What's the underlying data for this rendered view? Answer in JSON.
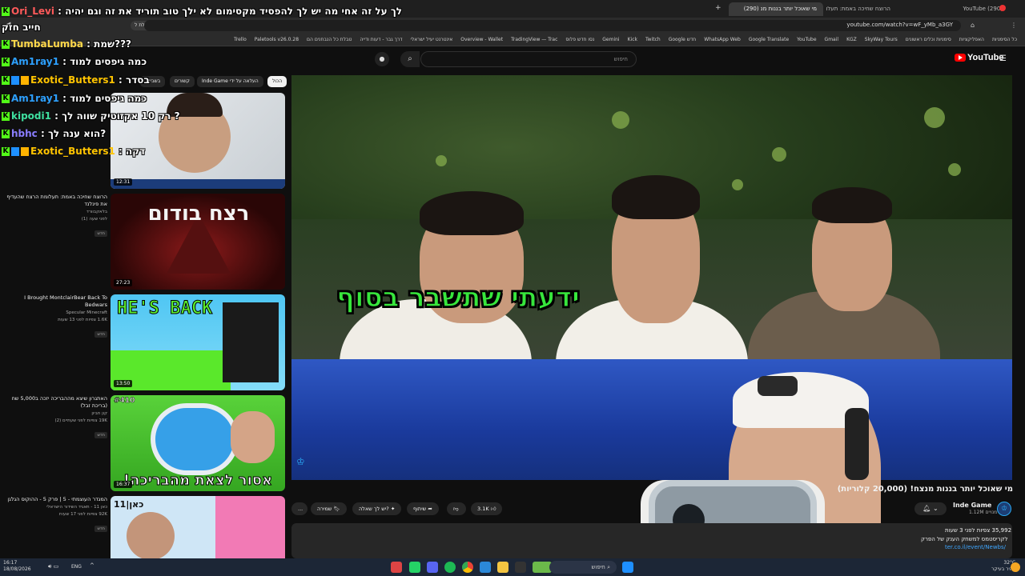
{
  "browser": {
    "tabs": [
      {
        "label": "YouTube (290)",
        "active": false
      },
      {
        "label": "הרוצח שחיכה באמת: תעלו (290)",
        "active": false
      },
      {
        "label": "מי שאוכל יותר בננות מנ (290)",
        "active": true
      }
    ],
    "new_tab": "+",
    "url": "youtube.com/watch?v=wF_yMb_a3GY",
    "profile_label": "שאכלת ל- Google",
    "bookmarks": [
      "Trello",
      "Paletools v26.0.28",
      "טבלת כל הנבחנים הם",
      "דרך גבר - דעות ודייה",
      "אינטרנט יעיל ישראלי",
      "Overview - Wallet",
      "TradingView — Trac",
      "נסו חדש פלוס",
      "Gemini",
      "Kick",
      "Twitch",
      "Google חדש",
      "WhatsApp Web",
      "Google Translate",
      "YouTube",
      "Gmail",
      "KGZ",
      "SkyWay Tours",
      "סימניות וכלים ראשונים",
      "האפליקציות",
      "כל הסימניות"
    ]
  },
  "youtube": {
    "logo": "YouTube",
    "search_placeholder": "חיפוש",
    "chips": [
      "הכול",
      "Inde Game העלאה על ידי",
      "קשורים",
      "בשבילך",
      "בסדר"
    ],
    "video": {
      "overlay_text": "ידעתי שתשבר בסוף",
      "title": "מי שאוכל יותר בננות מנצח! (20,000 קלוריות)",
      "channel": "Inde Game",
      "subscribers": "1.12M מנויים",
      "likes": "3.1K",
      "share_label": "שיתוף",
      "ask_label": "יש לך שאלה?",
      "save_label": "שמירה",
      "more_label": "...",
      "stats": "35,992 צפיות  לפני 3 שעות",
      "desc_line1": "לקריסטמס למשחק הענק של הפרק",
      "desc_line2": "ter.co.il/event/Newbs/"
    },
    "recommended": [
      {
        "title": "הרוצח שחיכה באמת: תעלומת הרצח שהעדיף את פינלנד",
        "channel": "בלאקבוורד",
        "meta": "לפני שעה (1)",
        "badge": "חדש",
        "duration": "12:31"
      },
      {
        "title": "רצח בודום",
        "channel": "",
        "meta": "",
        "badge": "",
        "duration": "27:23"
      },
      {
        "title": "I Brought MontclairBear Back To Bedwars",
        "channel": "Specular Minecraft",
        "meta": "1.6K צפיות לפני 13 שעות",
        "badge": "חדש",
        "duration": "13:50"
      },
      {
        "title": "האתגרון שיצא מההבריכה יזכה ב5,000 שח (בריכת זבל)",
        "channel": "קון חביון",
        "meta": "19K צפיות לפני שעתיים (2)",
        "badge": "חדש",
        "duration": "16:37"
      },
      {
        "title": "המגדר העוצמתי - 5 | פרק 5 - ההוקוס הגלגן",
        "channel": "כאן 11 - תאגיד השידור הישראלי",
        "meta": "92K צפיות לפני 17 שעות",
        "badge": "חדש",
        "duration": ""
      }
    ],
    "thumb_texts": {
      "rec2_title": "רצח בודום",
      "rec3_title": "HE'S BACK",
      "rec4_badge": "#410",
      "rec4_title": "אסור לצאת מהבריכה!",
      "rec5_logo": "כאן|11"
    }
  },
  "chat": [
    {
      "user": "Ori_Levi",
      "message": "לך על זה אחי מה יש לך להפסיד מקסימום לא ילך טוב תוריד את זה וגם יהיה"
    },
    {
      "user": "",
      "message": "חייב חזק"
    },
    {
      "user": "TumbaLumba",
      "message": "שמת???"
    },
    {
      "user": "Am1ray1",
      "message": "כמה גיפסים למוד"
    },
    {
      "user": "Exotic_Butters1",
      "message": "בסדר"
    },
    {
      "user": "Am1ray1",
      "message": "כמה גיפסים למוד"
    },
    {
      "user": "kipodi1",
      "message": "רק 10 אקזוטיק שווה לך ?"
    },
    {
      "user": "hbhc",
      "message": "הוא ענה לך?"
    },
    {
      "user": "Exotic_Butters1",
      "message": "דקה"
    }
  ],
  "taskbar": {
    "time": "16:17",
    "date": "18/08/2026",
    "language": "ENG",
    "search_placeholder": "חיפוש",
    "temperature": "32°C",
    "weather": "בהיר בעיקר"
  },
  "colors": {
    "youtube_red": "#ff0000",
    "kick_green": "#53fc18",
    "overlay_green": "#37e63c",
    "chat_user": "#ffc400",
    "link_blue": "#3ea6ff"
  }
}
